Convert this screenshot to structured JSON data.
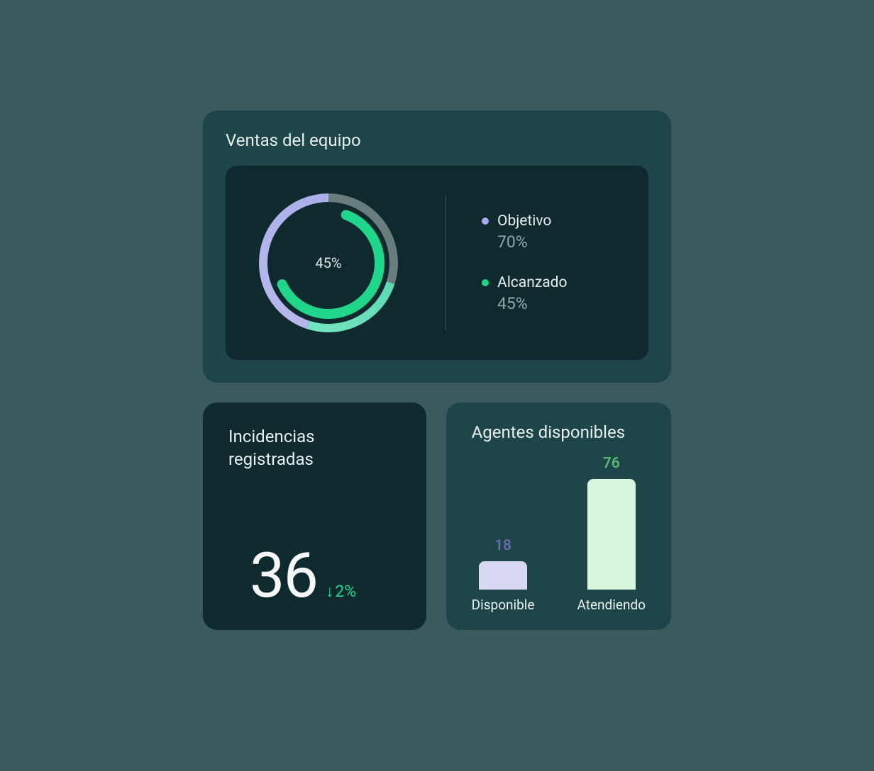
{
  "sales": {
    "title": "Ventas del equipo",
    "center_value": "45%",
    "legend": {
      "objective": {
        "label": "Objetivo",
        "value": "70%"
      },
      "reached": {
        "label": "Alcanzado",
        "value": "45%"
      }
    }
  },
  "incidents": {
    "title": "Incidencias registradas",
    "value": "36",
    "delta": "2%"
  },
  "agents": {
    "title": "Agentes disponibles",
    "available": {
      "value": "18",
      "label": "Disponible"
    },
    "attending": {
      "value": "76",
      "label": "Atendiendo"
    }
  },
  "chart_data": [
    {
      "type": "pie",
      "title": "Ventas del equipo",
      "series": [
        {
          "name": "Objetivo",
          "value": 70
        },
        {
          "name": "Alcanzado",
          "value": 45
        }
      ],
      "center_label": "45%"
    },
    {
      "type": "bar",
      "title": "Agentes disponibles",
      "categories": [
        "Disponible",
        "Atendiendo"
      ],
      "values": [
        18,
        76
      ]
    }
  ]
}
